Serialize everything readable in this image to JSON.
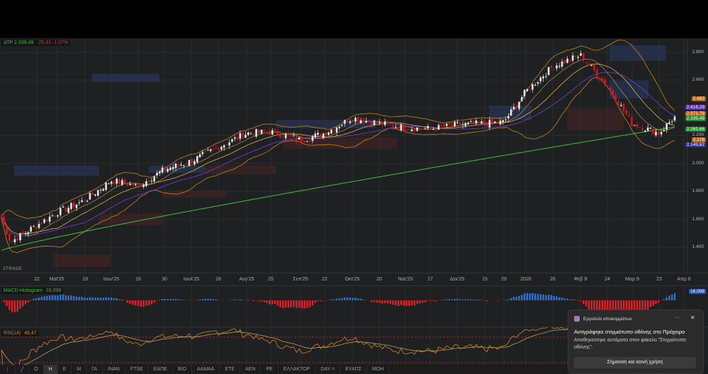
{
  "legend": {
    "symbol": "ΔΤΡ",
    "price": "2.339,49",
    "change": "-25,41",
    "change_pct": "-1,07%"
  },
  "watermark": "ZTRADE",
  "price_axis": [
    "2.800",
    "2.600",
    "2.200",
    "2.000",
    "1.800",
    "1.600",
    "1.400"
  ],
  "price_tags": [
    {
      "text": "2.482",
      "color": "#b8651d"
    },
    {
      "text": "2.416,29",
      "color": "#5b2fb8"
    },
    {
      "text": "2.371,79",
      "color": "#b8651d"
    },
    {
      "text": "2.339,49",
      "color": "#1e8e2e"
    },
    {
      "text": "2.265,66",
      "color": "#1e8e2e"
    },
    {
      "text": "2.176",
      "color": "#b8651d"
    },
    {
      "text": "2.149,62",
      "color": "#2e2f8e"
    }
  ],
  "chart_data": {
    "type": "candlestick",
    "x_ticks": [
      "22",
      "Μαϊ'25",
      "19",
      "Ιουν'25",
      "16",
      "30",
      "Ιουλ'25",
      "28",
      "Αυγ'25",
      "25",
      "Σεπ'25",
      "22",
      "Οκτ'25",
      "20",
      "Νοε'25",
      "17",
      "Δεκ'25",
      "15",
      "29",
      "2026",
      "26",
      "Φεβ 9",
      "24",
      "Μαρ 9",
      "23",
      "Απρ 6"
    ],
    "approx_close_at_ticks": [
      1560,
      1650,
      1740,
      1880,
      1840,
      1960,
      2020,
      2120,
      2220,
      2230,
      2170,
      2220,
      2330,
      2290,
      2260,
      2250,
      2280,
      2290,
      2300,
      2520,
      2700,
      2780,
      2560,
      2290,
      2220,
      null
    ],
    "first_close": 1640,
    "last_close": 2339.49,
    "ylim": [
      1300,
      2870
    ],
    "sma200_last": 2265.66,
    "colors": {
      "up": "#e6e6e6",
      "down": "#d3151c",
      "sma200": "#3cc03c",
      "bb": "#c9861f",
      "ma_purple": "#7a3fe0",
      "macd_pos": "#2f6fd6",
      "macd_neg": "#e0202a",
      "rsi": "#d9822b",
      "rsi_ma": "#b9a060"
    },
    "macd": {
      "label": "MACD-Histogram",
      "value": "16,098"
    },
    "rsi": {
      "label": "RSI(14)",
      "value": "48,47",
      "levels": [
        70,
        30
      ]
    }
  },
  "toolbar": [
    "⋮",
    "╱",
    "Ο",
    "Η",
    "Ε",
    "Μ",
    "ΓΑ",
    "ΙΝΑΝ",
    "FTSE",
    "ΕΑΠΕ",
    "ΒΙΟ",
    "ΑΑΜΑΑ",
    "ΕΤΕ",
    "ΑΕΝ",
    "ΡΕ",
    "ΕΛΛΑΚΤΟΡ",
    "DAY =",
    " ΕΥΑΠΣ",
    "ΜΟΗ"
  ],
  "notification": {
    "app": "Εργαλείο αποκομμάτων",
    "title": "Αντιγράφηκε στιγμιότυπο οθόνης στο Πρόχειρο",
    "body": "Αποθηκεύτηκε αυτόματα στον φάκελο \"Στιγμιότυπα οθόνης\".",
    "button": "Σήμανση και κοινή χρήση",
    "more": "···",
    "close": "✕"
  }
}
